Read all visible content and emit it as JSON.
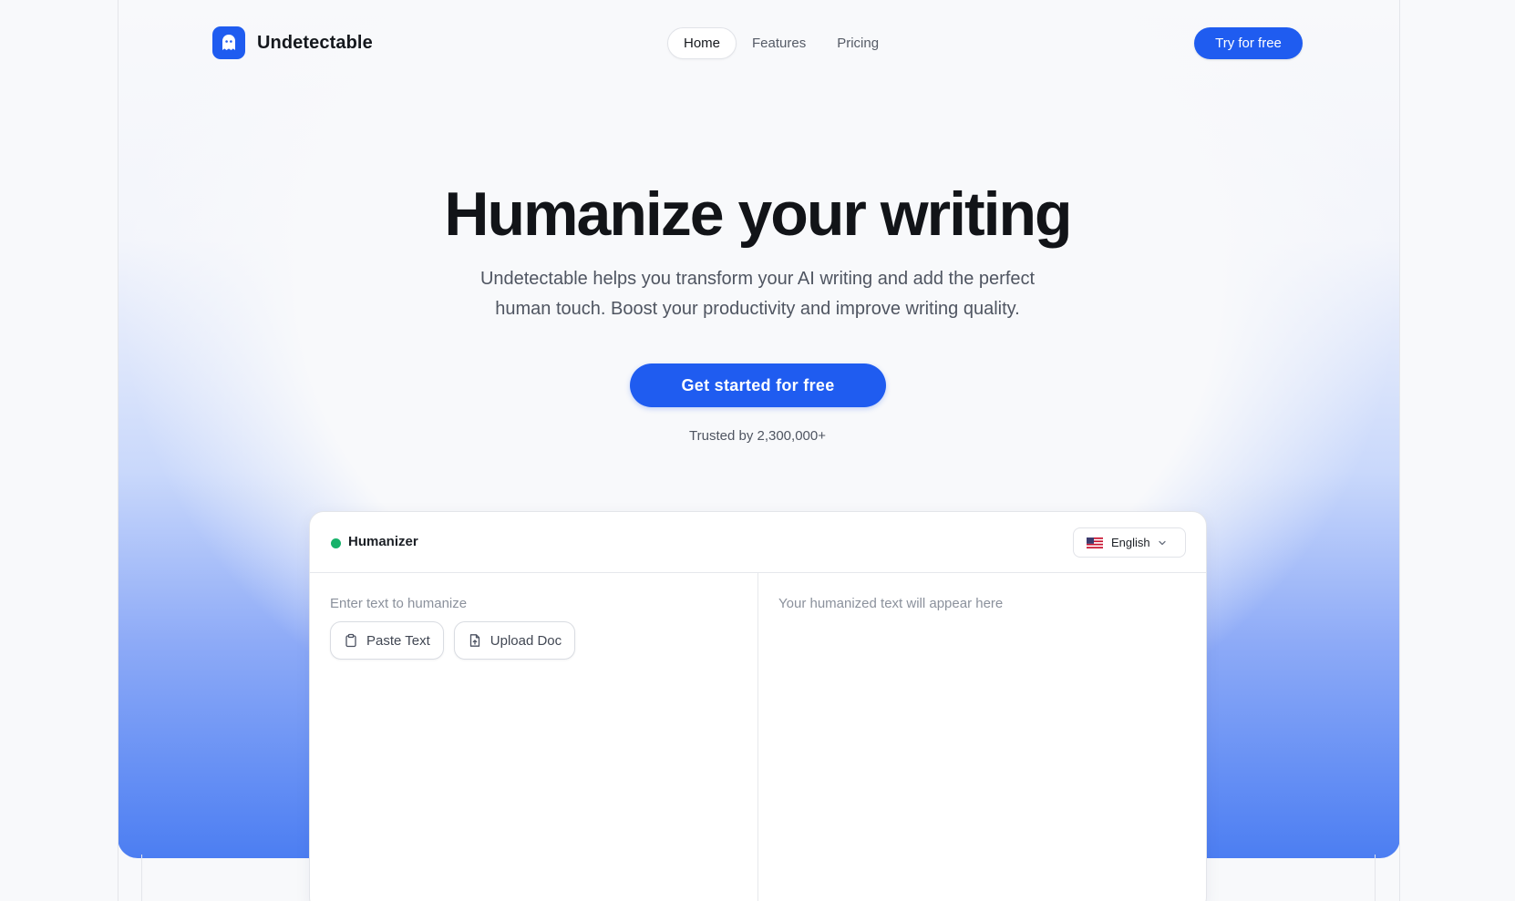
{
  "brand": {
    "name": "Undetectable",
    "logo_icon": "ghost-icon",
    "accent": "#1f5cf0"
  },
  "nav": {
    "items": [
      {
        "label": "Home",
        "active": true
      },
      {
        "label": "Features",
        "active": false
      },
      {
        "label": "Pricing",
        "active": false
      }
    ]
  },
  "header": {
    "cta_label": "Try for free"
  },
  "hero": {
    "title": "Humanize your writing",
    "subtitle_line1": "Undetectable helps you transform your AI writing and add the perfect",
    "subtitle_line2": "human touch. Boost your productivity and improve writing quality.",
    "cta_label": "Get started for free",
    "trusted": "Trusted by 2,300,000+"
  },
  "humanizer": {
    "title": "Humanizer",
    "status_color": "#17b26a",
    "language": {
      "selected": "English",
      "flag_icon": "us-flag-icon"
    },
    "input": {
      "placeholder": "Enter text to humanize",
      "paste_label": "Paste Text",
      "upload_label": "Upload Doc"
    },
    "output": {
      "placeholder": "Your humanized text will appear here"
    }
  }
}
